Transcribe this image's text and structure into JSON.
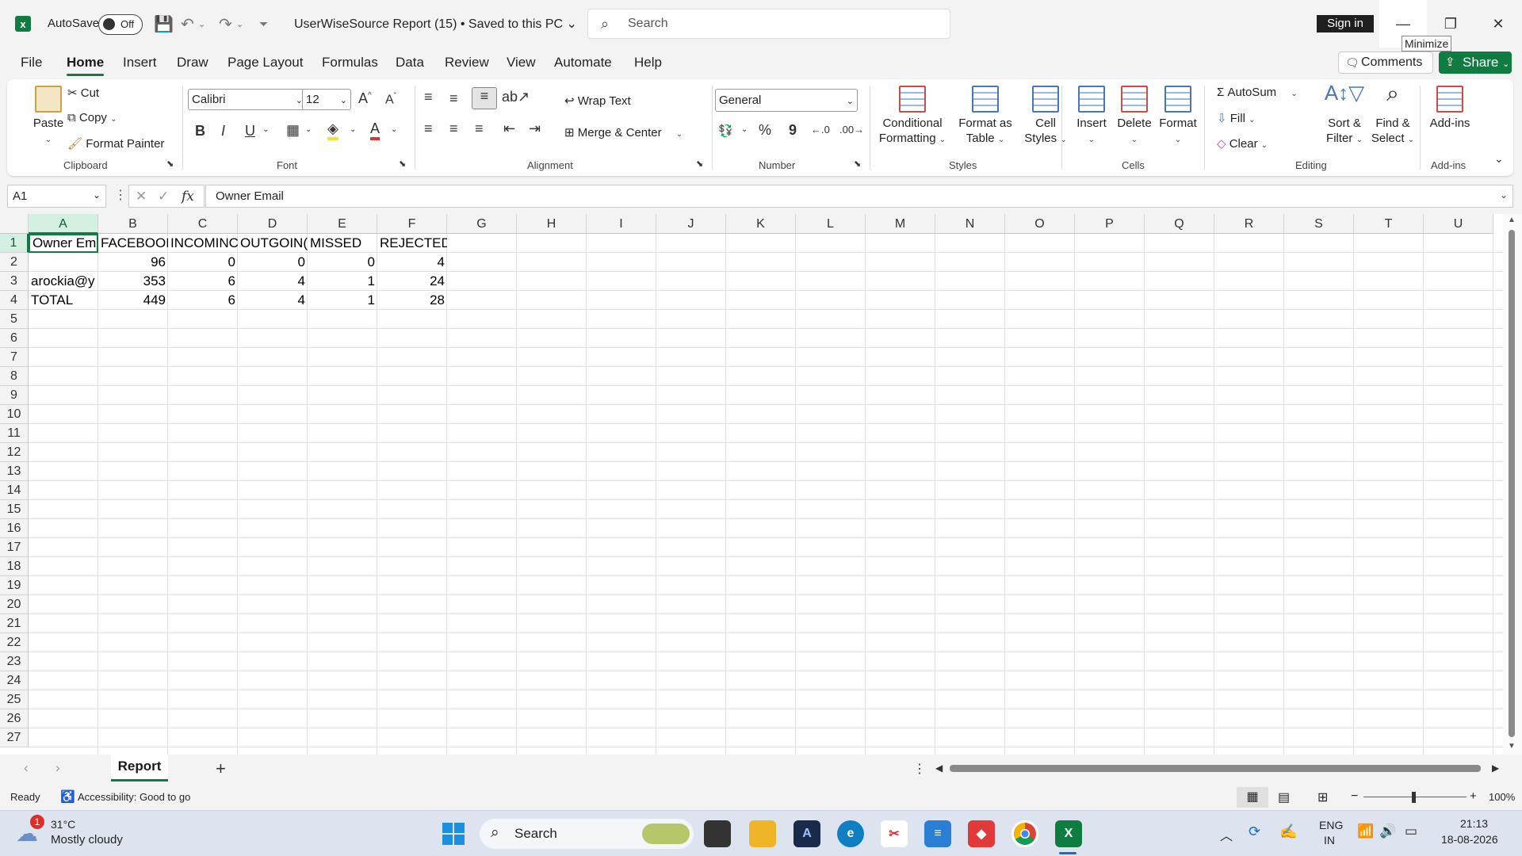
{
  "titlebar": {
    "autosave_label": "AutoSave",
    "autosave_state": "Off",
    "doc_title": "UserWiseSource Report (15)  •  Saved to this PC",
    "search_placeholder": "Search",
    "signin_label": "Sign in",
    "tooltip": "Minimize"
  },
  "menu": {
    "items": [
      "File",
      "Home",
      "Insert",
      "Draw",
      "Page Layout",
      "Formulas",
      "Data",
      "Review",
      "View",
      "Automate",
      "Help"
    ],
    "comments": "Comments",
    "share": "Share"
  },
  "ribbon": {
    "clipboard": {
      "paste": "Paste",
      "cut": "Cut",
      "copy": "Copy",
      "format_painter": "Format Painter",
      "label": "Clipboard"
    },
    "font": {
      "name": "Calibri",
      "size": "12",
      "label": "Font",
      "bold": "B",
      "italic": "I",
      "underline": "U"
    },
    "alignment": {
      "wrap": "Wrap Text",
      "merge": "Merge & Center",
      "label": "Alignment"
    },
    "number": {
      "format": "General",
      "label": "Number"
    },
    "styles": {
      "conditional": "Conditional Formatting",
      "format_table": "Format as Table",
      "cell_styles": "Cell Styles",
      "label": "Styles"
    },
    "cells": {
      "insert": "Insert",
      "delete": "Delete",
      "format": "Format",
      "label": "Cells"
    },
    "editing": {
      "autosum": "AutoSum",
      "fill": "Fill",
      "clear": "Clear",
      "sort": "Sort & Filter",
      "find": "Find & Select",
      "label": "Editing"
    },
    "addins": {
      "addins": "Add-ins",
      "label": "Add-ins"
    }
  },
  "formula_bar": {
    "name_box": "A1",
    "formula": "Owner Email"
  },
  "sheet": {
    "columns": [
      "A",
      "B",
      "C",
      "D",
      "E",
      "F",
      "G",
      "H",
      "I",
      "J",
      "K",
      "L",
      "M",
      "N",
      "O",
      "P",
      "Q",
      "R",
      "S",
      "T",
      "U"
    ],
    "rows": [
      "1",
      "2",
      "3",
      "4",
      "5",
      "6",
      "7",
      "8",
      "9",
      "10",
      "11",
      "12",
      "13",
      "14",
      "15",
      "16",
      "17",
      "18",
      "19",
      "20",
      "21",
      "22",
      "23",
      "24",
      "25",
      "26",
      "27"
    ],
    "cells": {
      "r1": [
        "Owner Em",
        "FACEBOOI",
        "INCOMINC",
        "OUTGOIN(",
        "MISSED",
        "REJECTED"
      ],
      "r2": [
        "",
        "96",
        "0",
        "0",
        "0",
        "4"
      ],
      "r3": [
        "arockia@y",
        "353",
        "6",
        "4",
        "1",
        "24"
      ],
      "r4": [
        "TOTAL",
        "449",
        "6",
        "4",
        "1",
        "28"
      ]
    },
    "tab": "Report"
  },
  "status": {
    "ready": "Ready",
    "accessibility": "Accessibility: Good to go",
    "zoom": "100%"
  },
  "taskbar": {
    "weather_temp": "31°C",
    "weather_desc": "Mostly cloudy",
    "weather_badge": "1",
    "search": "Search",
    "lang1": "ENG",
    "lang2": "IN",
    "time": "21:13",
    "date": "18-08-2026"
  },
  "colors": {
    "accent": "#107c41"
  }
}
